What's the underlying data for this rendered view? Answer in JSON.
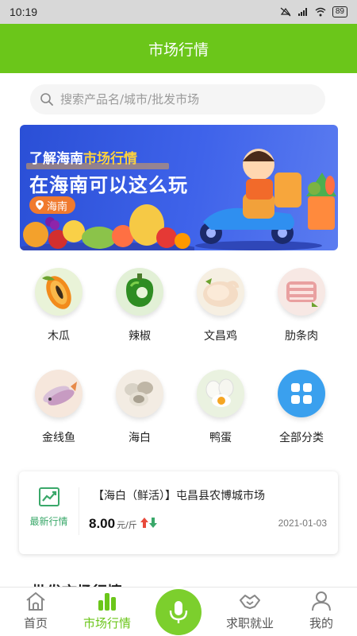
{
  "statusbar": {
    "time": "10:19",
    "battery": "89"
  },
  "header": {
    "title": "市场行情"
  },
  "search": {
    "placeholder": "搜索产品名/城市/批发市场"
  },
  "banner": {
    "line1_prefix": "了解海南",
    "line1_highlight": "市场行情",
    "line2": "在海南可以这么玩",
    "location": "海南"
  },
  "categories": [
    {
      "label": "木瓜",
      "icon": "papaya-icon"
    },
    {
      "label": "辣椒",
      "icon": "pepper-icon"
    },
    {
      "label": "文昌鸡",
      "icon": "chicken-icon"
    },
    {
      "label": "肋条肉",
      "icon": "pork-rib-icon"
    },
    {
      "label": "金线鱼",
      "icon": "fish-icon"
    },
    {
      "label": "海白",
      "icon": "clam-icon"
    },
    {
      "label": "鸭蛋",
      "icon": "duck-egg-icon"
    },
    {
      "label": "全部分类",
      "icon": "grid-icon"
    }
  ],
  "latest_card": {
    "badge_label": "最新行情",
    "title": "【海白（鲜活）】屯昌县农博城市场",
    "price": "8.00",
    "unit": "元/斤",
    "date": "2021-01-03"
  },
  "section": {
    "title": "批发市场行情"
  },
  "tabbar": {
    "items": [
      {
        "label": "首页",
        "icon": "home-icon"
      },
      {
        "label": "市场行情",
        "icon": "bar-chart-icon",
        "active": true
      },
      {
        "label": "求职就业",
        "icon": "handshake-icon"
      },
      {
        "label": "我的",
        "icon": "user-icon"
      }
    ],
    "mic_icon": "microphone-icon"
  },
  "colors": {
    "brand_green": "#6bc61a",
    "price_up": "#e84a3c",
    "price_down": "#3aa86a"
  }
}
